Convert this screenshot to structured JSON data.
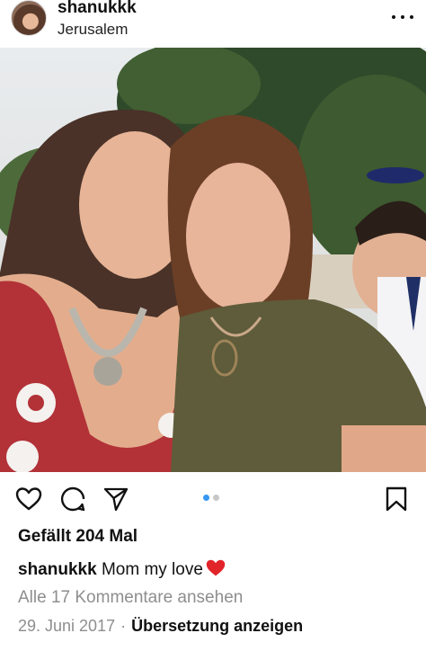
{
  "post": {
    "username": "shanukkk",
    "location": "Jerusalem",
    "likes_text": "Gefällt 204 Mal",
    "caption_user": "shanukkk",
    "caption_text": "Mom my love",
    "view_comments": "Alle 17 Kommentare ansehen",
    "date": "29. Juni 2017",
    "separator": "·",
    "translate_link": "Übersetzung anzeigen"
  },
  "carousel": {
    "total": 2,
    "active": 1
  },
  "icons": {
    "more": "more-horizontal-icon",
    "like": "heart-outline-icon",
    "comment": "comment-bubble-icon",
    "share": "paper-plane-icon",
    "save": "bookmark-icon",
    "caption_emoji": "red-heart-emoji"
  },
  "colors": {
    "carousel_active": "#3897f0",
    "carousel_inactive": "#c7c7c7",
    "secondary_text": "#8e8e8e",
    "emoji_heart": "#e0242a"
  }
}
